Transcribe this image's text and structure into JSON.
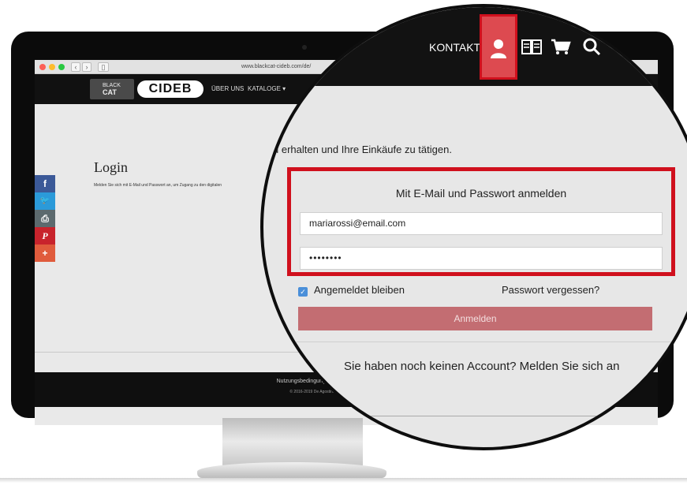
{
  "browser": {
    "url": "www.blackcat-cideb.com/de/"
  },
  "site": {
    "logo_black": "BLACK",
    "logo_cat": "CAT",
    "logo_cideb": "CIDEB",
    "nav": [
      {
        "label": "ÜBER UNS"
      },
      {
        "label": "KATALOGE ▾"
      }
    ]
  },
  "social": {
    "buttons": [
      {
        "glyph": "f",
        "color": "#3b5998",
        "icon": "facebook-icon"
      },
      {
        "glyph": "🐦",
        "color": "#2b9ad9",
        "icon": "twitter-icon"
      },
      {
        "glyph": "⎙",
        "color": "#5c6a6e",
        "icon": "print-icon"
      },
      {
        "glyph": "P",
        "color": "#c8232c",
        "icon": "pinterest-icon"
      },
      {
        "glyph": "+",
        "color": "#e05b3c",
        "icon": "plus-icon"
      }
    ]
  },
  "page": {
    "title": "Login",
    "subtitle": "Melden Sie sich mit E-Mail und Passwort an, um Zugang zu den digitalen"
  },
  "footer": {
    "links": "Nutzungsbedingungen | Datenschutz | Allgemeine Gesch",
    "copyright": "© 2016-2019 De Agostini Scuola - VAT.ID IT01792180034 - De A"
  },
  "magnifier": {
    "kontakt": "KONTAKT",
    "intro": "u erhalten und Ihre Einkäufe zu tätigen.",
    "form_title": "Mit E-Mail und Passwort anmelden",
    "email_value": "mariarossi@email.com",
    "password_value": "••••••••",
    "remember_label": "Angemeldet bleiben",
    "forgot_label": "Passwort vergessen?",
    "submit_label": "Anmelden",
    "register_text": "Sie haben noch keinen Account? Melden Sie sich an"
  },
  "colors": {
    "accent_red": "#d0101d",
    "button": "#c36d72"
  }
}
